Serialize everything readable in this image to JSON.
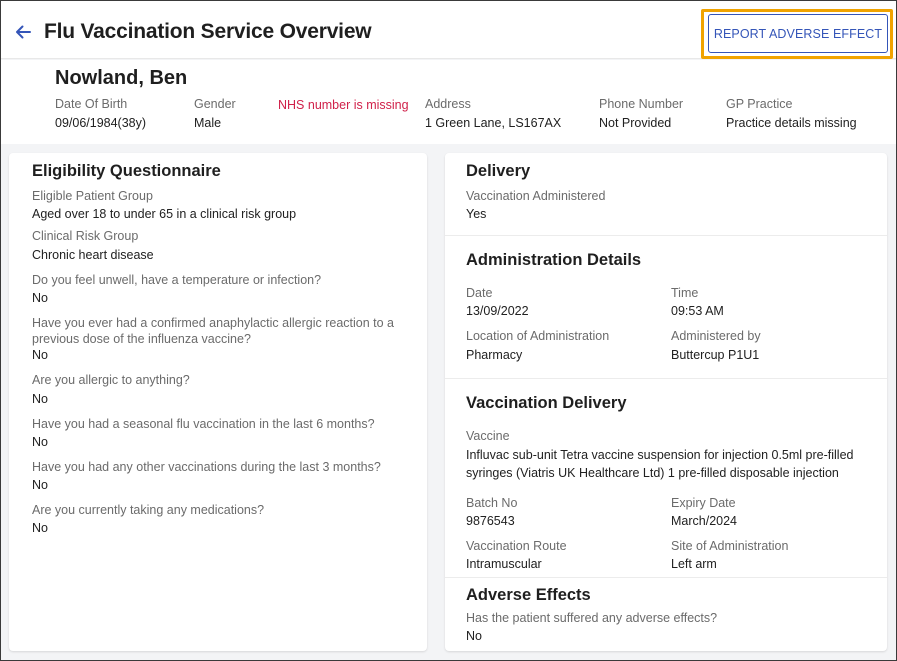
{
  "header": {
    "title": "Flu Vaccination Service Overview",
    "report_button": "REPORT ADVERSE EFFECT",
    "highlight_color": "#f0a300",
    "accent_color": "#3455b8"
  },
  "patient": {
    "name": "Nowland, Ben",
    "dob_label": "Date Of Birth",
    "dob_value": "09/06/1984(38y)",
    "gender_label": "Gender",
    "gender_value": "Male",
    "nhs_warning": "NHS number is missing",
    "address_label": "Address",
    "address_value": "1 Green Lane, LS167AX",
    "phone_label": "Phone Number",
    "phone_value": "Not Provided",
    "gp_label": "GP Practice",
    "gp_warning": "Practice details missing",
    "warning_color": "#d0214a"
  },
  "eligibility": {
    "title": "Eligibility Questionnaire",
    "items": [
      {
        "label": "Eligible Patient Group",
        "value": "Aged over 18 to under 65 in a clinical risk group"
      },
      {
        "label": "Clinical Risk Group",
        "value": "Chronic heart disease"
      },
      {
        "label": "Do you feel unwell, have a temperature or infection?",
        "value": "No"
      },
      {
        "label": "Have you ever had a confirmed anaphylactic allergic reaction to a previous dose of the influenza vaccine?",
        "value": "No"
      },
      {
        "label": "Are you allergic to anything?",
        "value": "No"
      },
      {
        "label": "Have you had a seasonal flu vaccination in the last 6 months?",
        "value": "No"
      },
      {
        "label": "Have you had any other vaccinations during the last 3 months?",
        "value": "No"
      },
      {
        "label": "Are you currently taking any medications?",
        "value": "No"
      }
    ]
  },
  "delivery": {
    "title": "Delivery",
    "administered_label": "Vaccination Administered",
    "administered_value": "Yes"
  },
  "administration": {
    "title": "Administration Details",
    "date_label": "Date",
    "date_value": "13/09/2022",
    "time_label": "Time",
    "time_value": "09:53 AM",
    "location_label": "Location of Administration",
    "location_value": "Pharmacy",
    "by_label": "Administered by",
    "by_value": "Buttercup P1U1"
  },
  "vaccination_delivery": {
    "title": "Vaccination Delivery",
    "vaccine_label": "Vaccine",
    "vaccine_value": "Influvac sub-unit Tetra vaccine suspension for injection 0.5ml pre-filled syringes (Viatris UK Healthcare Ltd) 1 pre-filled disposable injection",
    "batch_label": "Batch No",
    "batch_value": "9876543",
    "expiry_label": "Expiry Date",
    "expiry_value": "March/2024",
    "route_label": "Vaccination Route",
    "route_value": "Intramuscular",
    "site_label": "Site of Administration",
    "site_value": "Left arm"
  },
  "adverse": {
    "title": "Adverse Effects",
    "question_label": "Has the patient suffered any adverse effects?",
    "question_value": "No"
  }
}
